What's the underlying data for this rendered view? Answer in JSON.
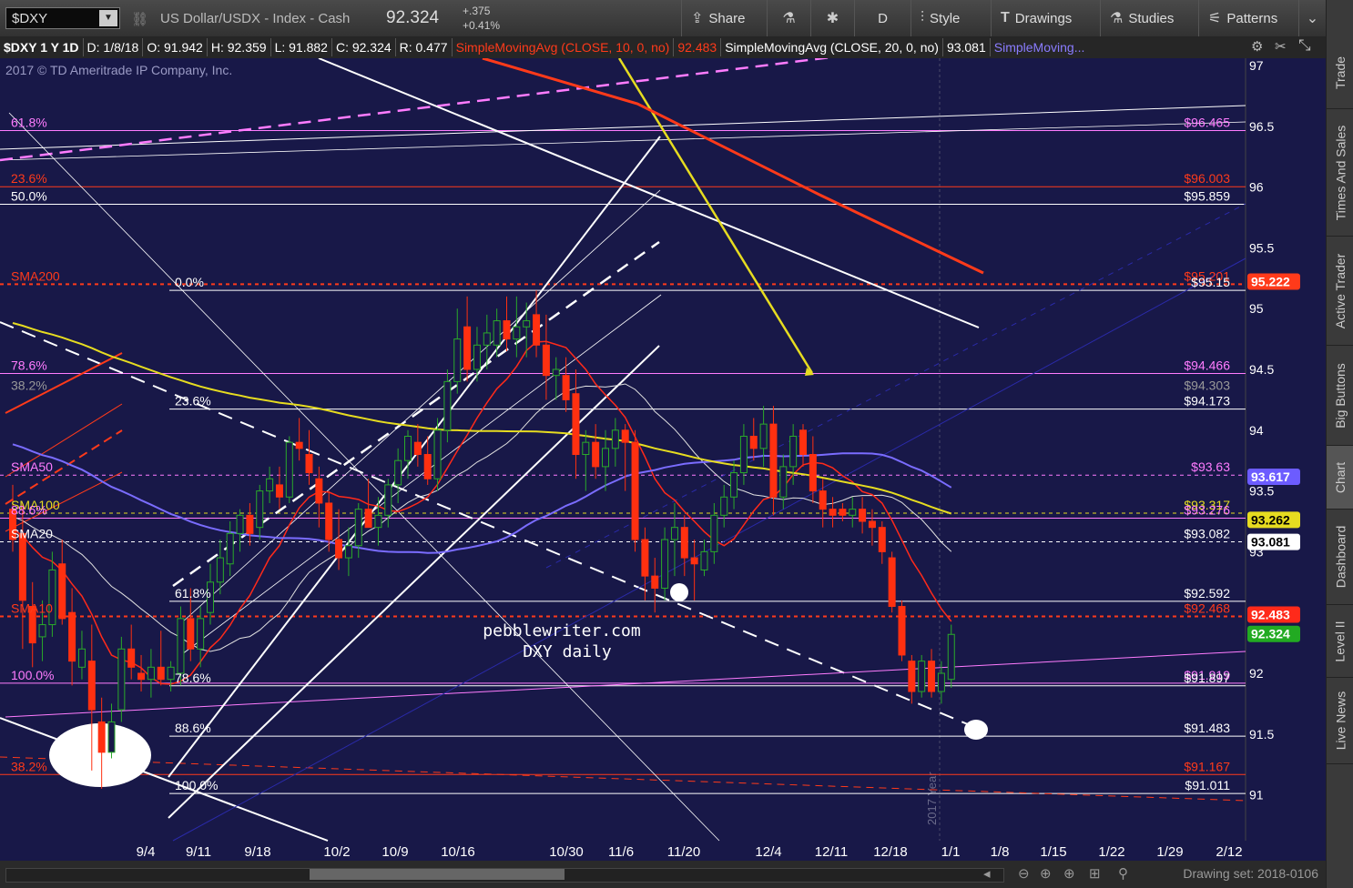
{
  "toolbar": {
    "symbol": "$DXY",
    "description": "US Dollar/USDX - Index - Cash",
    "last": "92.324",
    "change": "+.375",
    "change_pct": "+0.41%",
    "buttons": [
      {
        "label": "Share",
        "icon": "share-icon"
      },
      {
        "label": "",
        "icon": "flask-icon"
      },
      {
        "label": "",
        "icon": "gear-icon"
      },
      {
        "label": "D",
        "icon": ""
      },
      {
        "label": "Style",
        "icon": "style-icon"
      },
      {
        "label": "Drawings",
        "icon": "drawings-icon"
      },
      {
        "label": "Studies",
        "icon": "studies-icon"
      },
      {
        "label": "Patterns",
        "icon": "patterns-icon"
      }
    ]
  },
  "status": {
    "symbol_period": "$DXY 1 Y 1D",
    "date": "D: 1/8/18",
    "open": "O: 91.942",
    "high": "H: 92.359",
    "low": "L: 91.882",
    "close": "C: 92.324",
    "range": "R: 0.477",
    "sma10_label": "SimpleMovingAvg (CLOSE, 10, 0, no)",
    "sma10_value": "92.483",
    "sma20_label": "SimpleMovingAvg (CLOSE, 20, 0, no)",
    "sma20_value": "93.081",
    "sma_more": "SimpleMoving..."
  },
  "copyright": "2017 © TD Ameritrade IP Company, Inc.",
  "watermark": {
    "line1": "pebblewriter.com",
    "line2": "DXY daily"
  },
  "year_marker": "2017 Year",
  "drawing_set": "Drawing set: 2018-0106",
  "right_tabs": [
    "Trade",
    "Times And Sales",
    "Active Trader",
    "Big Buttons",
    "Chart",
    "Dashboard",
    "Level II",
    "Live News"
  ],
  "active_tab": "Chart",
  "colors": {
    "background": "#181848",
    "up": "#2aaa2a",
    "down": "#ff3010",
    "sma10": "#ff2a1a",
    "sma20": "#e0e0e0",
    "sma50": "#7a6cff",
    "sma100": "#e6dc20",
    "sma200": "#ff3a1a",
    "fib_pink": "#ff6cff"
  },
  "chart_data": {
    "type": "candlestick",
    "title": "",
    "ylim": [
      90.5,
      97.1
    ],
    "y_ticks": [
      91,
      91.5,
      92,
      92.5,
      93,
      93.5,
      94,
      94.5,
      95,
      95.5,
      96,
      96.5,
      97
    ],
    "x_ticks": [
      "9/4",
      "9/11",
      "9/18",
      "10/2",
      "10/9",
      "10/16",
      "10/30",
      "11/6",
      "11/20",
      "12/4",
      "12/11",
      "12/18",
      "1/1",
      "1/8",
      "1/15",
      "1/22",
      "1/29",
      "2/12"
    ],
    "candles": [
      {
        "o": 93.35,
        "h": 93.55,
        "l": 93.0,
        "c": 93.1
      },
      {
        "o": 93.15,
        "h": 93.4,
        "l": 92.2,
        "c": 92.6
      },
      {
        "o": 92.55,
        "h": 92.75,
        "l": 92.05,
        "c": 92.25
      },
      {
        "o": 92.3,
        "h": 92.6,
        "l": 92.1,
        "c": 92.4
      },
      {
        "o": 92.4,
        "h": 93.0,
        "l": 92.3,
        "c": 92.85
      },
      {
        "o": 92.9,
        "h": 93.1,
        "l": 92.4,
        "c": 92.45
      },
      {
        "o": 92.5,
        "h": 92.7,
        "l": 91.9,
        "c": 92.1
      },
      {
        "o": 92.05,
        "h": 92.35,
        "l": 91.95,
        "c": 92.2
      },
      {
        "o": 92.1,
        "h": 92.4,
        "l": 91.2,
        "c": 91.7
      },
      {
        "o": 91.6,
        "h": 91.8,
        "l": 91.05,
        "c": 91.35
      },
      {
        "o": 91.35,
        "h": 91.75,
        "l": 91.3,
        "c": 91.6
      },
      {
        "o": 91.7,
        "h": 92.3,
        "l": 91.6,
        "c": 92.2
      },
      {
        "o": 92.2,
        "h": 92.4,
        "l": 91.95,
        "c": 92.05
      },
      {
        "o": 92.0,
        "h": 92.15,
        "l": 91.85,
        "c": 91.95
      },
      {
        "o": 91.95,
        "h": 92.2,
        "l": 91.8,
        "c": 92.05
      },
      {
        "o": 92.05,
        "h": 92.35,
        "l": 91.9,
        "c": 91.95
      },
      {
        "o": 91.95,
        "h": 92.1,
        "l": 91.85,
        "c": 92.05
      },
      {
        "o": 92.0,
        "h": 92.55,
        "l": 91.9,
        "c": 92.45
      },
      {
        "o": 92.45,
        "h": 92.7,
        "l": 92.1,
        "c": 92.2
      },
      {
        "o": 92.2,
        "h": 92.55,
        "l": 92.05,
        "c": 92.45
      },
      {
        "o": 92.5,
        "h": 92.9,
        "l": 92.4,
        "c": 92.75
      },
      {
        "o": 92.75,
        "h": 93.1,
        "l": 92.65,
        "c": 92.95
      },
      {
        "o": 92.9,
        "h": 93.25,
        "l": 92.8,
        "c": 93.15
      },
      {
        "o": 93.15,
        "h": 93.35,
        "l": 93.0,
        "c": 93.3
      },
      {
        "o": 93.3,
        "h": 93.4,
        "l": 93.05,
        "c": 93.15
      },
      {
        "o": 93.2,
        "h": 93.55,
        "l": 93.1,
        "c": 93.5
      },
      {
        "o": 93.5,
        "h": 93.7,
        "l": 93.4,
        "c": 93.6
      },
      {
        "o": 93.55,
        "h": 93.7,
        "l": 93.35,
        "c": 93.45
      },
      {
        "o": 93.45,
        "h": 93.95,
        "l": 93.4,
        "c": 93.9
      },
      {
        "o": 93.9,
        "h": 94.1,
        "l": 93.75,
        "c": 93.85
      },
      {
        "o": 93.8,
        "h": 94.0,
        "l": 93.55,
        "c": 93.65
      },
      {
        "o": 93.6,
        "h": 93.7,
        "l": 93.2,
        "c": 93.4
      },
      {
        "o": 93.4,
        "h": 93.5,
        "l": 93.0,
        "c": 93.1
      },
      {
        "o": 93.1,
        "h": 93.35,
        "l": 92.85,
        "c": 92.95
      },
      {
        "o": 92.95,
        "h": 93.2,
        "l": 92.8,
        "c": 93.05
      },
      {
        "o": 93.05,
        "h": 93.4,
        "l": 92.95,
        "c": 93.35
      },
      {
        "o": 93.35,
        "h": 93.6,
        "l": 93.2,
        "c": 93.2
      },
      {
        "o": 93.2,
        "h": 93.45,
        "l": 93.05,
        "c": 93.3
      },
      {
        "o": 93.3,
        "h": 93.6,
        "l": 93.2,
        "c": 93.55
      },
      {
        "o": 93.55,
        "h": 93.85,
        "l": 93.4,
        "c": 93.75
      },
      {
        "o": 93.75,
        "h": 94.0,
        "l": 93.6,
        "c": 93.95
      },
      {
        "o": 93.9,
        "h": 94.05,
        "l": 93.7,
        "c": 93.8
      },
      {
        "o": 93.8,
        "h": 93.95,
        "l": 93.55,
        "c": 93.6
      },
      {
        "o": 93.6,
        "h": 94.1,
        "l": 93.5,
        "c": 94.0
      },
      {
        "o": 94.0,
        "h": 94.5,
        "l": 93.9,
        "c": 94.4
      },
      {
        "o": 94.4,
        "h": 95.0,
        "l": 94.3,
        "c": 94.75
      },
      {
        "o": 94.85,
        "h": 95.1,
        "l": 94.4,
        "c": 94.5
      },
      {
        "o": 94.5,
        "h": 94.85,
        "l": 94.4,
        "c": 94.7
      },
      {
        "o": 94.7,
        "h": 94.95,
        "l": 94.5,
        "c": 94.8
      },
      {
        "o": 94.7,
        "h": 95.0,
        "l": 94.6,
        "c": 94.9
      },
      {
        "o": 94.9,
        "h": 95.1,
        "l": 94.65,
        "c": 94.75
      },
      {
        "o": 94.75,
        "h": 95.1,
        "l": 94.6,
        "c": 94.85
      },
      {
        "o": 94.85,
        "h": 95.05,
        "l": 94.6,
        "c": 94.9
      },
      {
        "o": 94.95,
        "h": 95.15,
        "l": 94.6,
        "c": 94.7
      },
      {
        "o": 94.7,
        "h": 94.95,
        "l": 94.25,
        "c": 94.45
      },
      {
        "o": 94.45,
        "h": 94.6,
        "l": 94.25,
        "c": 94.5
      },
      {
        "o": 94.45,
        "h": 94.6,
        "l": 94.15,
        "c": 94.25
      },
      {
        "o": 94.3,
        "h": 94.5,
        "l": 93.6,
        "c": 93.8
      },
      {
        "o": 93.8,
        "h": 94.0,
        "l": 93.5,
        "c": 93.9
      },
      {
        "o": 93.9,
        "h": 94.05,
        "l": 93.6,
        "c": 93.7
      },
      {
        "o": 93.7,
        "h": 94.0,
        "l": 93.5,
        "c": 93.85
      },
      {
        "o": 93.85,
        "h": 94.1,
        "l": 93.7,
        "c": 94.0
      },
      {
        "o": 94.0,
        "h": 94.05,
        "l": 93.5,
        "c": 93.9
      },
      {
        "o": 93.9,
        "h": 94.0,
        "l": 93.0,
        "c": 93.1
      },
      {
        "o": 93.1,
        "h": 93.2,
        "l": 92.6,
        "c": 92.8
      },
      {
        "o": 92.8,
        "h": 92.95,
        "l": 92.5,
        "c": 92.7
      },
      {
        "o": 92.7,
        "h": 93.2,
        "l": 92.6,
        "c": 93.1
      },
      {
        "o": 93.1,
        "h": 93.4,
        "l": 92.8,
        "c": 93.2
      },
      {
        "o": 93.2,
        "h": 93.3,
        "l": 92.8,
        "c": 92.95
      },
      {
        "o": 92.95,
        "h": 93.1,
        "l": 92.6,
        "c": 92.9
      },
      {
        "o": 92.85,
        "h": 93.1,
        "l": 92.8,
        "c": 93.0
      },
      {
        "o": 93.0,
        "h": 93.4,
        "l": 92.9,
        "c": 93.3
      },
      {
        "o": 93.3,
        "h": 93.55,
        "l": 93.2,
        "c": 93.45
      },
      {
        "o": 93.45,
        "h": 93.75,
        "l": 93.35,
        "c": 93.65
      },
      {
        "o": 93.65,
        "h": 94.05,
        "l": 93.55,
        "c": 93.95
      },
      {
        "o": 93.95,
        "h": 94.1,
        "l": 93.75,
        "c": 93.85
      },
      {
        "o": 93.85,
        "h": 94.2,
        "l": 93.7,
        "c": 94.05
      },
      {
        "o": 94.05,
        "h": 94.2,
        "l": 93.3,
        "c": 93.45
      },
      {
        "o": 93.45,
        "h": 93.8,
        "l": 93.35,
        "c": 93.7
      },
      {
        "o": 93.7,
        "h": 94.05,
        "l": 93.55,
        "c": 93.95
      },
      {
        "o": 94.0,
        "h": 94.05,
        "l": 93.7,
        "c": 93.8
      },
      {
        "o": 93.8,
        "h": 93.95,
        "l": 93.4,
        "c": 93.5
      },
      {
        "o": 93.5,
        "h": 93.6,
        "l": 93.2,
        "c": 93.35
      },
      {
        "o": 93.35,
        "h": 93.45,
        "l": 93.2,
        "c": 93.3
      },
      {
        "o": 93.35,
        "h": 93.4,
        "l": 93.25,
        "c": 93.3
      },
      {
        "o": 93.3,
        "h": 93.45,
        "l": 93.2,
        "c": 93.35
      },
      {
        "o": 93.35,
        "h": 93.45,
        "l": 93.15,
        "c": 93.25
      },
      {
        "o": 93.25,
        "h": 93.35,
        "l": 93.05,
        "c": 93.2
      },
      {
        "o": 93.2,
        "h": 93.25,
        "l": 92.9,
        "c": 93.0
      },
      {
        "o": 92.95,
        "h": 93.0,
        "l": 92.5,
        "c": 92.55
      },
      {
        "o": 92.55,
        "h": 92.6,
        "l": 92.1,
        "c": 92.15
      },
      {
        "o": 92.1,
        "h": 92.15,
        "l": 91.75,
        "c": 91.85
      },
      {
        "o": 91.85,
        "h": 92.15,
        "l": 91.8,
        "c": 92.1
      },
      {
        "o": 92.1,
        "h": 92.2,
        "l": 91.8,
        "c": 91.85
      },
      {
        "o": 91.85,
        "h": 92.1,
        "l": 91.75,
        "c": 92.0
      },
      {
        "o": 91.95,
        "h": 92.4,
        "l": 91.88,
        "c": 92.32
      }
    ],
    "horizontal_levels": [
      {
        "label_left": "61.8%",
        "label_right": "$96.465",
        "price": 96.465,
        "color": "#ff7cff",
        "style": "solid"
      },
      {
        "label_left": "23.6%",
        "label_right": "$96.003",
        "price": 96.003,
        "color": "#ff3a1a",
        "style": "solid"
      },
      {
        "label_left": "50.0%",
        "label_right": "$95.859",
        "price": 95.859,
        "color": "#ffffff",
        "style": "solid"
      },
      {
        "label_left": "SMA200",
        "label_right": "$95.201",
        "price": 95.201,
        "color": "#ff3a1a",
        "style": "dotted"
      },
      {
        "label_left": "0.0%",
        "label_right": "$95.15",
        "price": 95.15,
        "color": "#ffffff",
        "style": "solid"
      },
      {
        "label_left": "78.6%",
        "label_right": "$94.466",
        "price": 94.466,
        "color": "#ff7cff",
        "style": "solid"
      },
      {
        "label_left": "38.2%",
        "label_right": "$94.303",
        "price": 94.303,
        "color": "#888888",
        "style": "none"
      },
      {
        "label_left": "23.6%",
        "label_right": "$94.173",
        "price": 94.173,
        "color": "#ffffff",
        "style": "solid"
      },
      {
        "label_left": "SMA50",
        "label_right": "$93.63",
        "price": 93.63,
        "color": "#ff7cff",
        "style": "dotted"
      },
      {
        "label_left": "SMA100",
        "label_right": "$93.317",
        "price": 93.317,
        "color": "#e6dc20",
        "style": "dotted"
      },
      {
        "label_left": "88.6%",
        "label_right": "$93.276",
        "price": 93.276,
        "color": "#ff7cff",
        "style": "solid"
      },
      {
        "label_left": "SMA20",
        "label_right": "$93.082",
        "price": 93.082,
        "color": "#ffffff",
        "style": "dotted"
      },
      {
        "label_left": "61.8%",
        "label_right": "$92.592",
        "price": 92.592,
        "color": "#ffffff",
        "style": "solid"
      },
      {
        "label_left": "SMA10",
        "label_right": "$92.468",
        "price": 92.468,
        "color": "#ff3a1a",
        "style": "dotted"
      },
      {
        "label_left": "100.0%",
        "label_right": "$91.919",
        "price": 91.919,
        "color": "#ff7cff",
        "style": "solid"
      },
      {
        "label_left": "78.6%",
        "label_right": "$91.897",
        "price": 91.897,
        "color": "#ffffff",
        "style": "solid"
      },
      {
        "label_left": "88.6%",
        "label_right": "$91.483",
        "price": 91.483,
        "color": "#ffffff",
        "style": "solid"
      },
      {
        "label_left": "38.2%",
        "label_right": "$91.167",
        "price": 91.167,
        "color": "#ff3a1a",
        "style": "solid"
      },
      {
        "label_left": "100.0%",
        "label_right": "$91.011",
        "price": 91.011,
        "color": "#ffffff",
        "style": "solid"
      }
    ],
    "price_tags": [
      {
        "value": "95.222",
        "bg": "#ff3a1a",
        "fg": "#ffffff"
      },
      {
        "value": "93.617",
        "bg": "#6c5cff",
        "fg": "#ffffff"
      },
      {
        "value": "93.262",
        "bg": "#e6dc20",
        "fg": "#000000"
      },
      {
        "value": "93.081",
        "bg": "#ffffff",
        "fg": "#000000"
      },
      {
        "value": "92.483",
        "bg": "#ff2a1a",
        "fg": "#ffffff"
      },
      {
        "value": "92.324",
        "bg": "#22aa22",
        "fg": "#ffffff"
      }
    ]
  }
}
